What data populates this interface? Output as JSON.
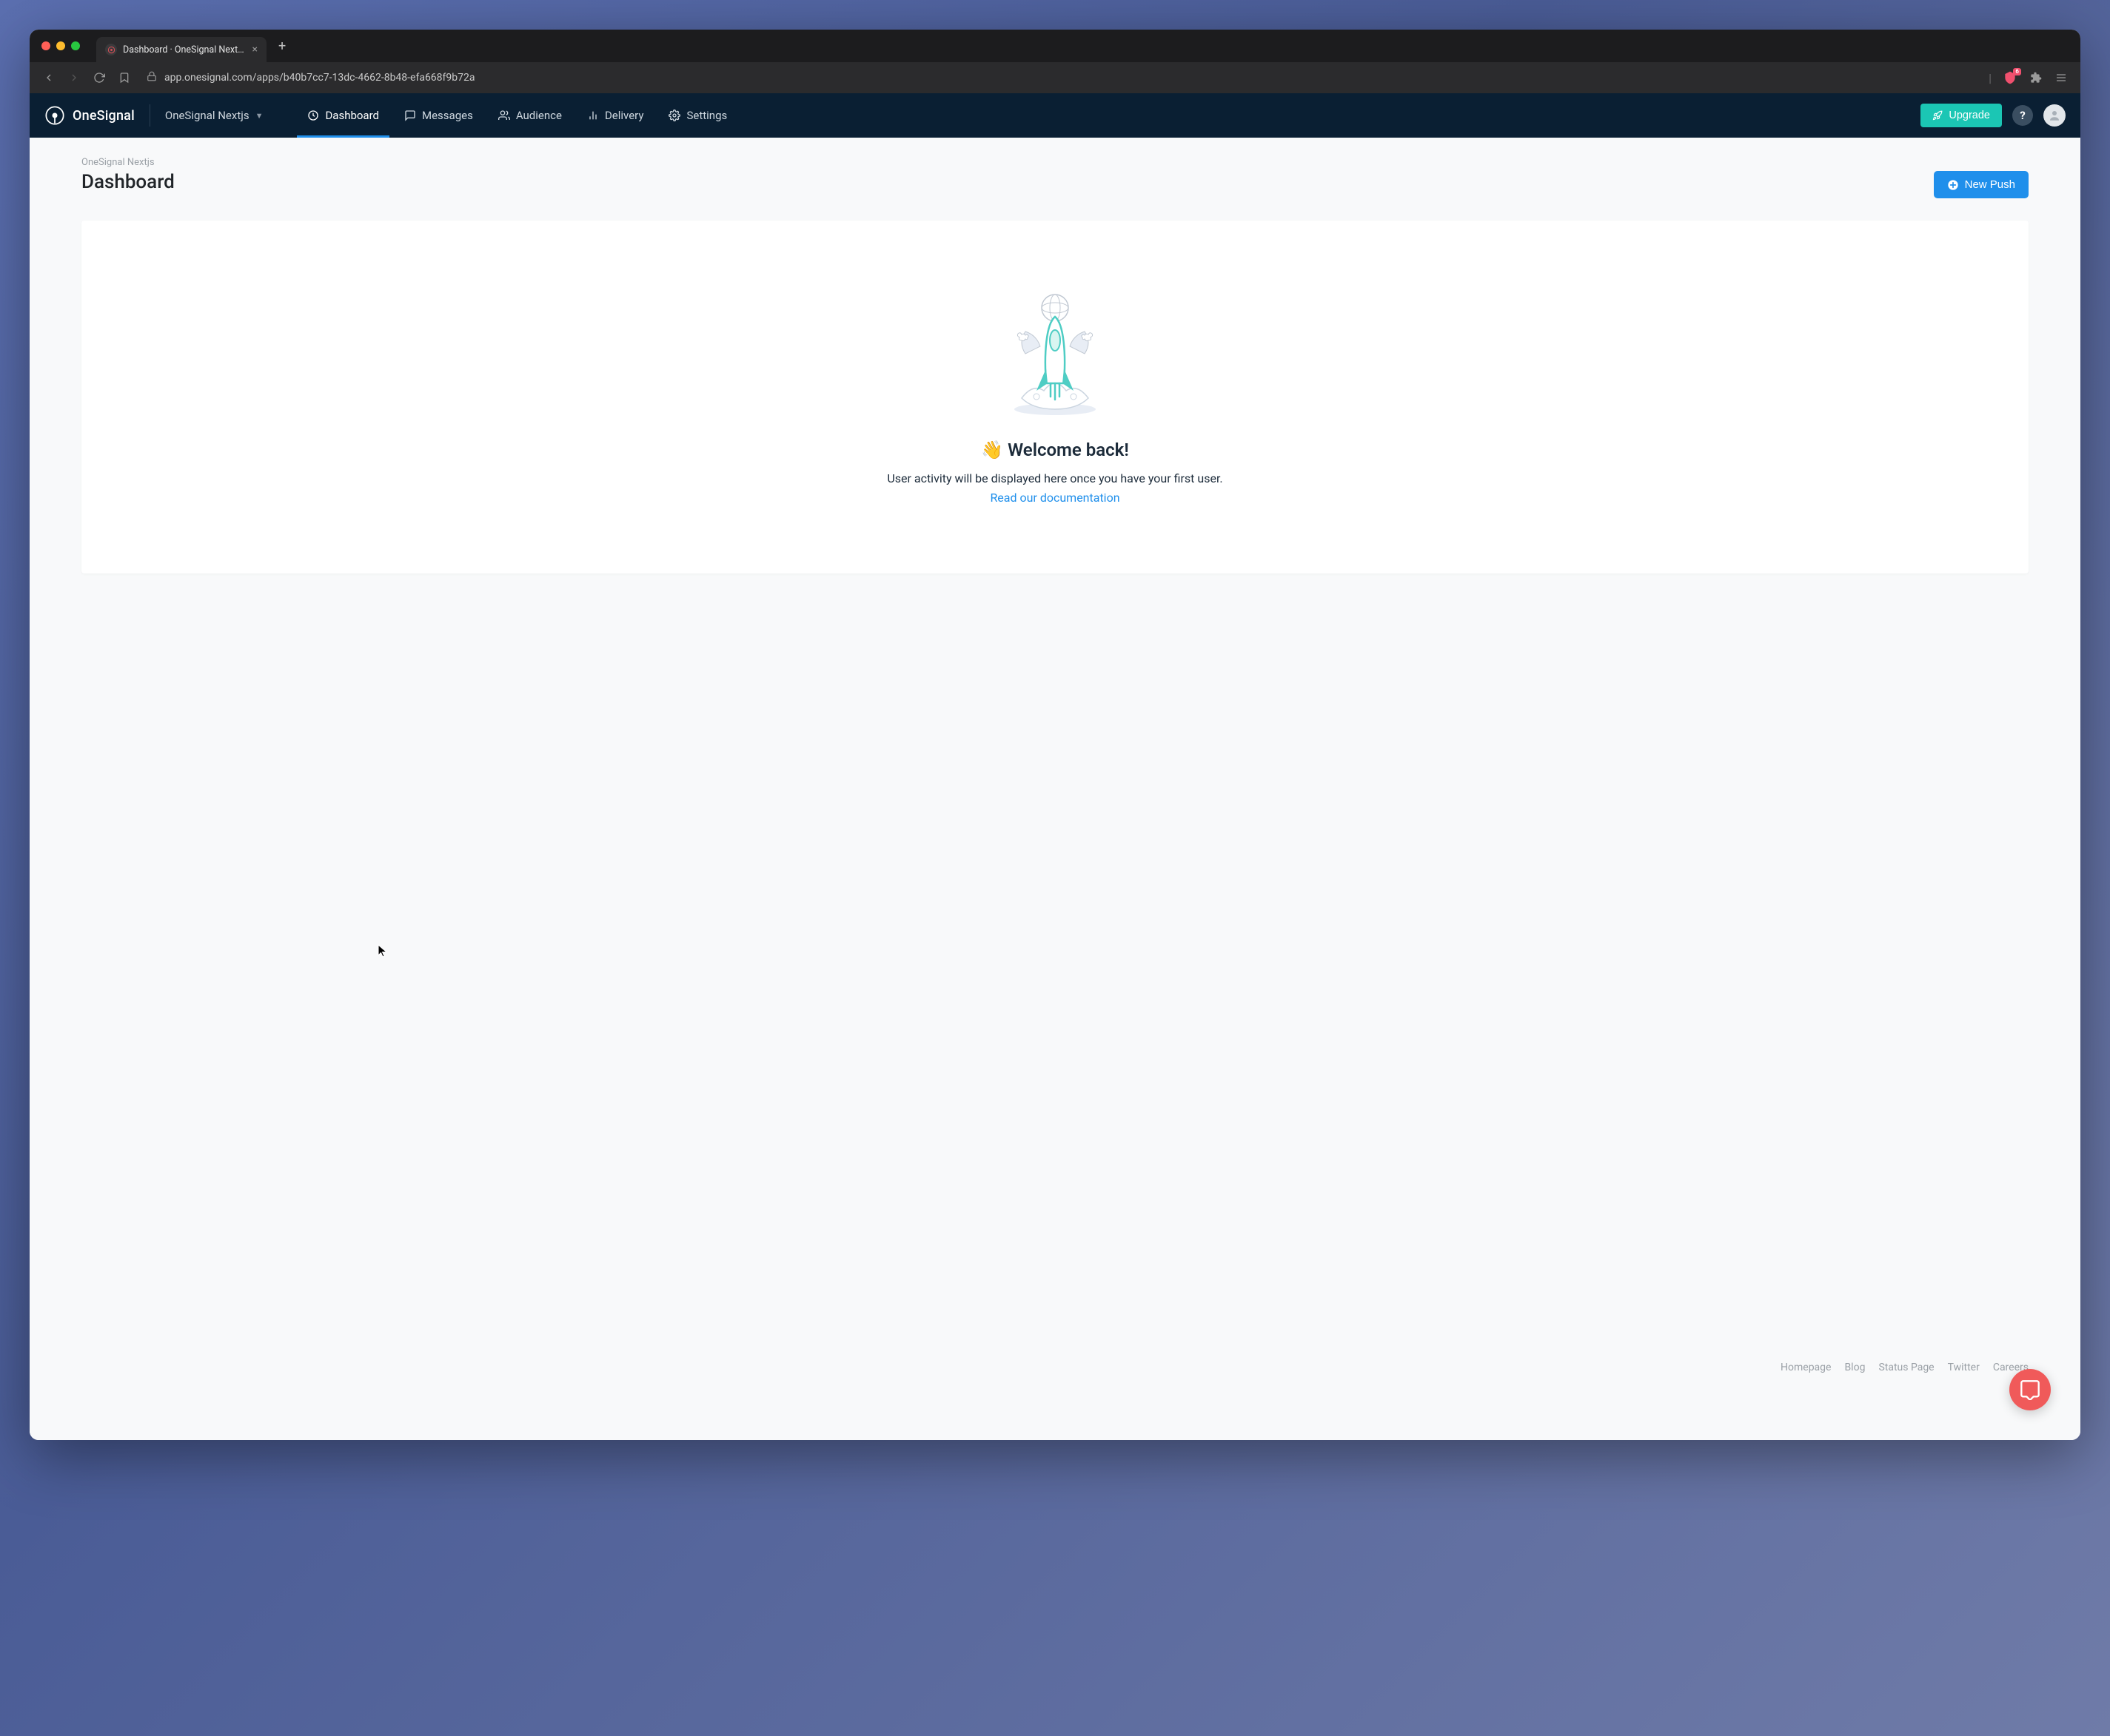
{
  "browser": {
    "tab_title": "Dashboard · OneSignal Nextjs |",
    "url": "app.onesignal.com/apps/b40b7cc7-13dc-4662-8b48-efa668f9b72a",
    "shield_count": "6"
  },
  "header": {
    "brand": "OneSignal",
    "app_name": "OneSignal Nextjs",
    "nav": {
      "dashboard": "Dashboard",
      "messages": "Messages",
      "audience": "Audience",
      "delivery": "Delivery",
      "settings": "Settings"
    },
    "upgrade": "Upgrade",
    "help": "?"
  },
  "page": {
    "breadcrumb": "OneSignal Nextjs",
    "title": "Dashboard",
    "new_push": "New Push",
    "welcome_title": "👋 Welcome back!",
    "welcome_sub": "User activity will be displayed here once you have your first user.",
    "doc_link": "Read our documentation"
  },
  "footer": {
    "homepage": "Homepage",
    "blog": "Blog",
    "status": "Status Page",
    "twitter": "Twitter",
    "careers": "Careers"
  }
}
